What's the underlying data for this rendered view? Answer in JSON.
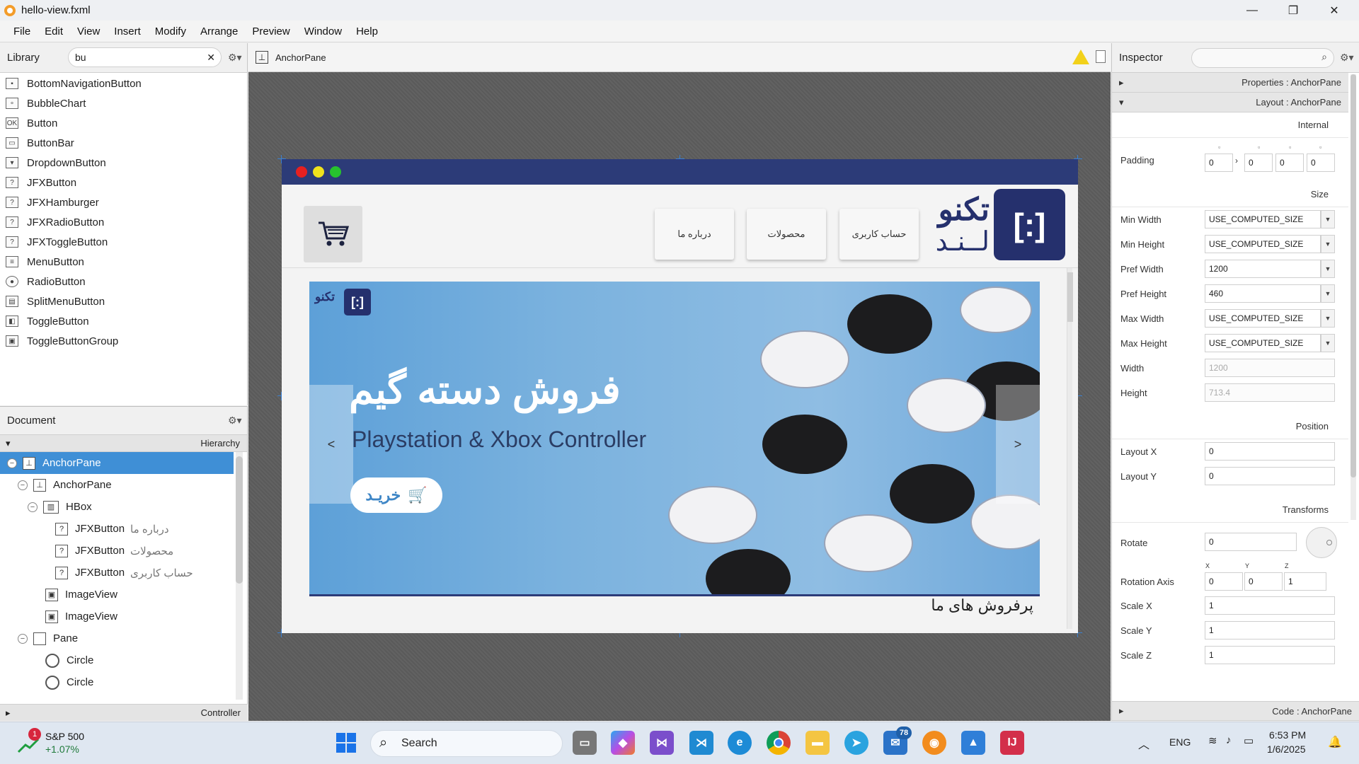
{
  "window": {
    "title": "hello-view.fxml",
    "minimize": "—",
    "maximize": "❐",
    "close": "✕"
  },
  "menu": [
    "File",
    "Edit",
    "View",
    "Insert",
    "Modify",
    "Arrange",
    "Preview",
    "Window",
    "Help"
  ],
  "library": {
    "title": "Library",
    "search_value": "bu",
    "clear": "✕",
    "items": [
      "BottomNavigationButton",
      "BubbleChart",
      "Button",
      "ButtonBar",
      "DropdownButton",
      "JFXButton",
      "JFXHamburger",
      "JFXRadioButton",
      "JFXToggleButton",
      "MenuButton",
      "RadioButton",
      "SplitMenuButton",
      "ToggleButton",
      "ToggleButtonGroup"
    ]
  },
  "document": {
    "title": "Document",
    "hierarchy_label": "Hierarchy",
    "controller_label": "Controller",
    "tree": [
      {
        "name": "AnchorPane",
        "extra": ""
      },
      {
        "name": "AnchorPane",
        "extra": ""
      },
      {
        "name": "HBox",
        "extra": ""
      },
      {
        "name": "JFXButton",
        "extra": "درباره ما"
      },
      {
        "name": "JFXButton",
        "extra": "محصولات"
      },
      {
        "name": "JFXButton",
        "extra": "حساب کاربری"
      },
      {
        "name": "ImageView",
        "extra": ""
      },
      {
        "name": "ImageView",
        "extra": ""
      },
      {
        "name": "Pane",
        "extra": ""
      },
      {
        "name": "Circle",
        "extra": ""
      },
      {
        "name": "Circle",
        "extra": ""
      }
    ]
  },
  "editor": {
    "breadcrumb": "AnchorPane"
  },
  "canvas": {
    "nav_buttons": [
      "درباره ما",
      "محصولات",
      "حساب کاربری"
    ],
    "brand_name": "تکنو",
    "brand_sub": "لــنـد",
    "banner_title": "فروش دسته گیم",
    "banner_subtitle": "Playstation & Xbox Controller",
    "buy_label": "خریـد",
    "prev": "<",
    "next": ">",
    "banner_logo_text": "تکنو",
    "section_title": "پرفروش های ما"
  },
  "inspector": {
    "title": "Inspector",
    "properties_section": "Properties : AnchorPane",
    "layout_section": "Layout : AnchorPane",
    "code_section": "Code : AnchorPane",
    "groups": {
      "internal": "Internal",
      "size": "Size",
      "position": "Position",
      "transforms": "Transforms"
    },
    "padding": {
      "label": "Padding",
      "values": [
        "0",
        "0",
        "0",
        "0"
      ]
    },
    "size": [
      {
        "label": "Min Width",
        "value": "USE_COMPUTED_SIZE",
        "dropdown": true,
        "disabled": false
      },
      {
        "label": "Min Height",
        "value": "USE_COMPUTED_SIZE",
        "dropdown": true,
        "disabled": false
      },
      {
        "label": "Pref Width",
        "value": "1200",
        "dropdown": true,
        "disabled": false
      },
      {
        "label": "Pref Height",
        "value": "460",
        "dropdown": true,
        "disabled": false
      },
      {
        "label": "Max Width",
        "value": "USE_COMPUTED_SIZE",
        "dropdown": true,
        "disabled": false
      },
      {
        "label": "Max Height",
        "value": "USE_COMPUTED_SIZE",
        "dropdown": true,
        "disabled": false
      },
      {
        "label": "Width",
        "value": "1200",
        "dropdown": false,
        "disabled": true
      },
      {
        "label": "Height",
        "value": "713.4",
        "dropdown": false,
        "disabled": true
      }
    ],
    "position": [
      {
        "label": "Layout X",
        "value": "0"
      },
      {
        "label": "Layout Y",
        "value": "0"
      }
    ],
    "rotate": {
      "label": "Rotate",
      "value": "0"
    },
    "rotation_axis": {
      "label": "Rotation Axis",
      "axes": [
        "X",
        "Y",
        "Z"
      ],
      "values": [
        "0",
        "0",
        "1"
      ]
    },
    "scale": [
      {
        "label": "Scale X",
        "value": "1"
      },
      {
        "label": "Scale Y",
        "value": "1"
      },
      {
        "label": "Scale Z",
        "value": "1"
      }
    ]
  },
  "taskbar": {
    "stock_name": "S&P 500",
    "stock_change": "+1.07%",
    "stock_badge": "1",
    "search_label": "Search",
    "lang": "ENG",
    "time": "6:53 PM",
    "date": "1/6/2025",
    "mail_badge": "78"
  }
}
